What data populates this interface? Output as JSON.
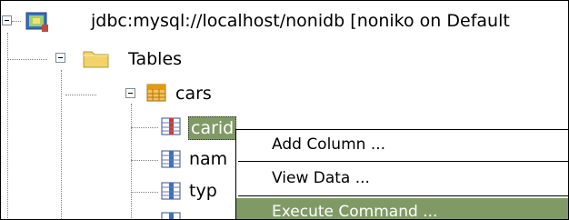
{
  "tree": {
    "connection_label": "jdbc:mysql://localhost/nonidb [noniko on Default",
    "tables_label": "Tables",
    "table_label": "cars",
    "columns": [
      "carid",
      "nam",
      "typ",
      ""
    ]
  },
  "context_menu": {
    "items": [
      "Add Column ...",
      "View Data ...",
      "Execute Command ..."
    ],
    "highlighted_index": 2
  },
  "colors": {
    "selection": "#7f9a65",
    "folder": "#f1d36a",
    "table_grid": "#e39b0d"
  }
}
